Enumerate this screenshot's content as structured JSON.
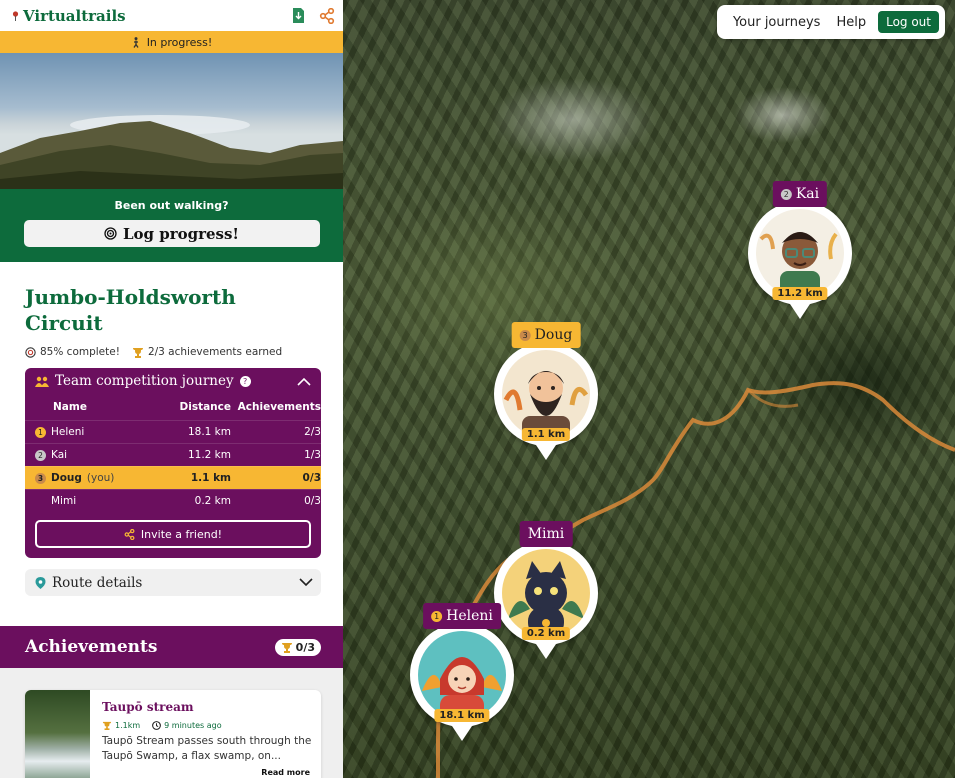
{
  "app": {
    "name": "Virtualtrails",
    "status": "In progress!"
  },
  "nav": {
    "journeys": "Your journeys",
    "help": "Help",
    "logout": "Log out"
  },
  "log": {
    "question": "Been out walking?",
    "button": "Log progress!"
  },
  "journey": {
    "title": "Jumbo-Holdsworth Circuit",
    "complete": "85% complete!",
    "achievements_earned": "2/3 achievements earned"
  },
  "team": {
    "title": "Team competition journey",
    "help": "?",
    "columns": [
      "Name",
      "Distance",
      "Achievements"
    ],
    "rows": [
      {
        "rank": "1",
        "name": "Heleni",
        "suffix": "",
        "distance": "18.1 km",
        "achievements": "2/3",
        "rank_color": "#f7b733"
      },
      {
        "rank": "2",
        "name": "Kai",
        "suffix": "",
        "distance": "11.2 km",
        "achievements": "1/3",
        "rank_color": "#c8c8c8"
      },
      {
        "rank": "3",
        "name": "Doug",
        "suffix": "(you)",
        "distance": "1.1 km",
        "achievements": "0/3",
        "rank_color": "#c98a4a"
      },
      {
        "rank": "",
        "name": "Mimi",
        "suffix": "",
        "distance": "0.2 km",
        "achievements": "0/3",
        "rank_color": ""
      }
    ],
    "invite": "Invite a friend!"
  },
  "route": {
    "label": "Route details"
  },
  "achievements": {
    "title": "Achievements",
    "count": "0/3",
    "card": {
      "title": "Taupō stream",
      "distance": "1.1km",
      "time": "9 minutes ago",
      "description": "Taupō Stream passes south through the Taupō Swamp, a flax swamp, on...",
      "more": "Read more"
    }
  },
  "markers": [
    {
      "id": "kai",
      "rank": "2",
      "name": "Kai",
      "distance": "11.2 km",
      "tag_color": "#6b0f5e"
    },
    {
      "id": "doug",
      "rank": "3",
      "name": "Doug",
      "distance": "1.1 km",
      "tag_color": "#f7b733"
    },
    {
      "id": "mimi",
      "rank": "",
      "name": "Mimi",
      "distance": "0.2 km",
      "tag_color": "#6b0f5e"
    },
    {
      "id": "heleni",
      "rank": "1",
      "name": "Heleni",
      "distance": "18.1 km",
      "tag_color": "#6b0f5e"
    }
  ],
  "colors": {
    "brand_green": "#0d6b3c",
    "accent_yellow": "#f7b733",
    "team_purple": "#6b0f5e",
    "trail_orange": "#d98a3a"
  }
}
